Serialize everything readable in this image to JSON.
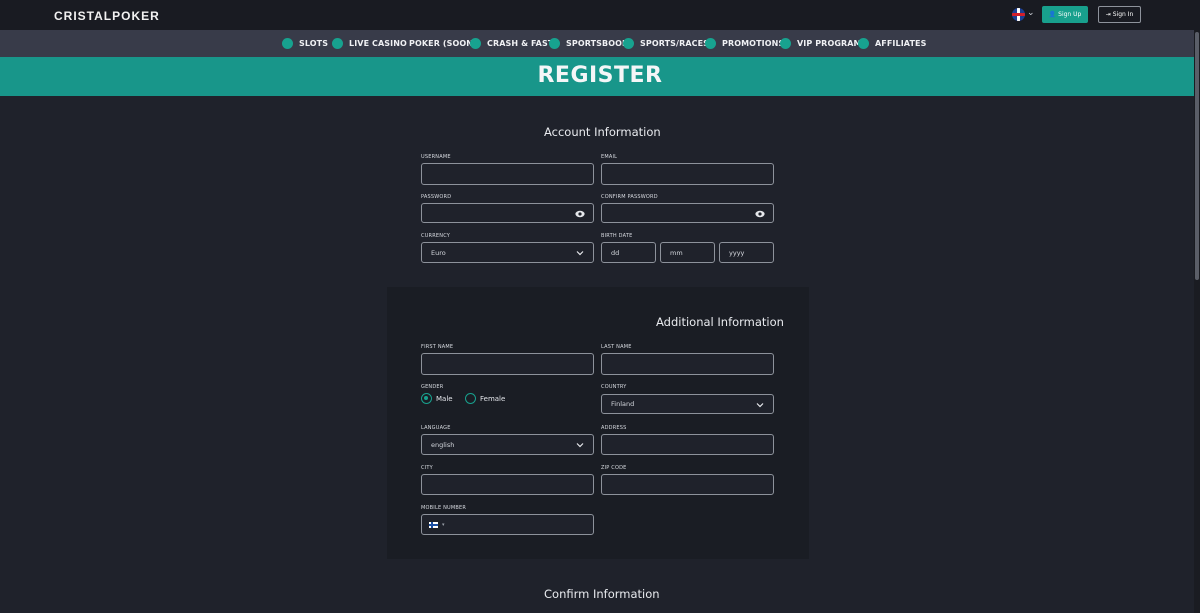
{
  "header": {
    "logo": "CRISTALPOKER",
    "signup_label": "Sign Up",
    "signin_label": "Sign In"
  },
  "nav": {
    "items": [
      {
        "label": "SLOTS",
        "icon": "slots-icon"
      },
      {
        "label": "LIVE CASINO",
        "icon": "live-casino-icon"
      },
      {
        "label": "POKER (SOON)",
        "icon": ""
      },
      {
        "label": "CRASH & FAST",
        "icon": "rocket-icon"
      },
      {
        "label": "SPORTSBOOK",
        "icon": "sports-icon"
      },
      {
        "label": "SPORTS/RACES",
        "icon": "races-icon"
      },
      {
        "label": "PROMOTIONS",
        "icon": "gift-icon"
      },
      {
        "label": "VIP PROGRAM",
        "icon": "crown-icon"
      },
      {
        "label": "AFFILIATES",
        "icon": "affiliates-icon"
      }
    ]
  },
  "page": {
    "title": "REGISTER"
  },
  "account": {
    "title": "Account Information",
    "username_label": "USERNAME",
    "email_label": "EMAIL",
    "password_label": "PASSWORD",
    "confirm_password_label": "CONFIRM PASSWORD",
    "currency_label": "CURRENCY",
    "currency_value": "Euro",
    "birthdate_label": "BIRTH DATE",
    "birth_dd": "dd",
    "birth_mm": "mm",
    "birth_yyyy": "yyyy"
  },
  "additional": {
    "title": "Additional Information",
    "first_name_label": "FIRST NAME",
    "last_name_label": "LAST NAME",
    "gender_label": "GENDER",
    "gender_male": "Male",
    "gender_female": "Female",
    "country_label": "COUNTRY",
    "country_value": "Finland",
    "language_label": "LANGUAGE",
    "language_value": "english",
    "address_label": "ADDRESS",
    "city_label": "CITY",
    "zip_label": "ZIP CODE",
    "mobile_label": "MOBILE NUMBER"
  },
  "confirm": {
    "title": "Confirm Information"
  },
  "colors": {
    "accent": "#18a08d",
    "banner": "#18968a",
    "background": "#1f222b"
  }
}
